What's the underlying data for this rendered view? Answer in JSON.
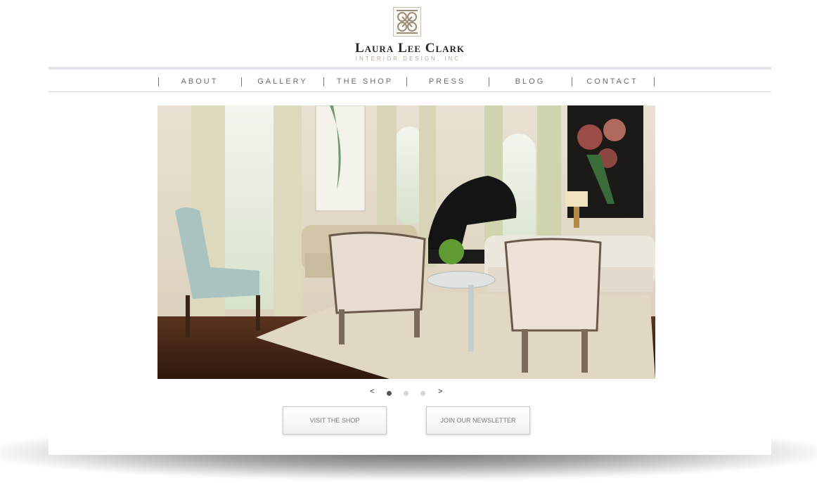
{
  "brand": {
    "name": "Laura Lee Clark",
    "tagline": "INTERIOR DESIGN, INC.",
    "emblem_icon": "ornamental-knot-logo"
  },
  "nav": {
    "items": [
      {
        "label": "ABOUT"
      },
      {
        "label": "GALLERY"
      },
      {
        "label": "THE SHOP"
      },
      {
        "label": "PRESS"
      },
      {
        "label": "BLOG"
      },
      {
        "label": "CONTACT"
      }
    ],
    "separator": "|"
  },
  "slider": {
    "image_icon": "living-room-photo",
    "prev_label": "<",
    "next_label": ">",
    "slide_count": 3,
    "active_slide": 1
  },
  "cta": {
    "shop_label": "VISIT THE SHOP",
    "newsletter_label": "JOIN OUR NEWSLETTER"
  },
  "colors": {
    "nav_text": "#6b6b6b",
    "nav_top_border": "#e3e4ea",
    "brand_text": "#2a241e",
    "brand_sub": "#b7a791",
    "dot_active": "#555555",
    "dot_inactive": "#d5d5d5"
  }
}
